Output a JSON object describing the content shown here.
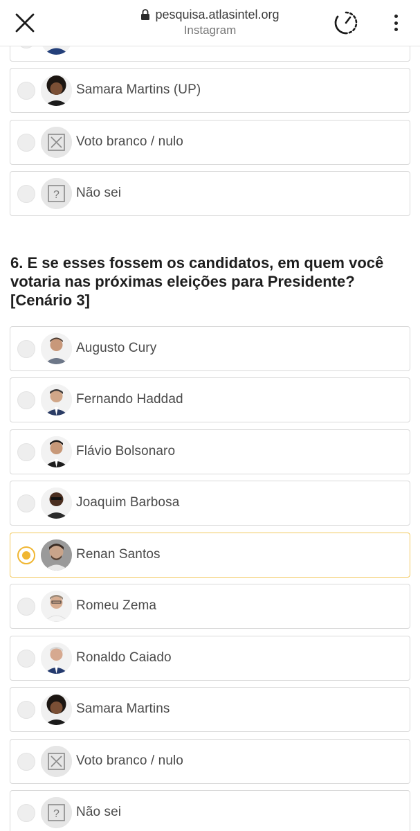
{
  "browser": {
    "url": "pesquisa.atlasintel.org",
    "subtitle": "Instagram"
  },
  "prev_question": {
    "options": [
      {
        "label": "Samara Martins (UP)",
        "icon": "person-photo"
      },
      {
        "label": "Voto branco / nulo",
        "icon": "x-box-icon"
      },
      {
        "label": "Não sei",
        "icon": "question-box-icon"
      }
    ]
  },
  "question": {
    "title": "6. E se esses fossem os candidatos, em quem você votaria nas próximas eleições para Presidente? [Cenário 3]",
    "selected": "Renan Santos",
    "options": [
      {
        "label": "Augusto Cury",
        "icon": "person-photo"
      },
      {
        "label": "Fernando Haddad",
        "icon": "person-photo"
      },
      {
        "label": "Flávio Bolsonaro",
        "icon": "person-photo"
      },
      {
        "label": "Joaquim Barbosa",
        "icon": "person-photo"
      },
      {
        "label": "Renan Santos",
        "icon": "person-photo"
      },
      {
        "label": "Romeu Zema",
        "icon": "person-photo"
      },
      {
        "label": "Ronaldo Caiado",
        "icon": "person-photo"
      },
      {
        "label": "Samara Martins",
        "icon": "person-photo"
      },
      {
        "label": "Voto branco / nulo",
        "icon": "x-box-icon"
      },
      {
        "label": "Não sei",
        "icon": "question-box-icon"
      }
    ]
  },
  "colors": {
    "selected_accent": "#f0b632",
    "selected_border": "#f2c95e",
    "option_border": "#d9d9d9"
  }
}
